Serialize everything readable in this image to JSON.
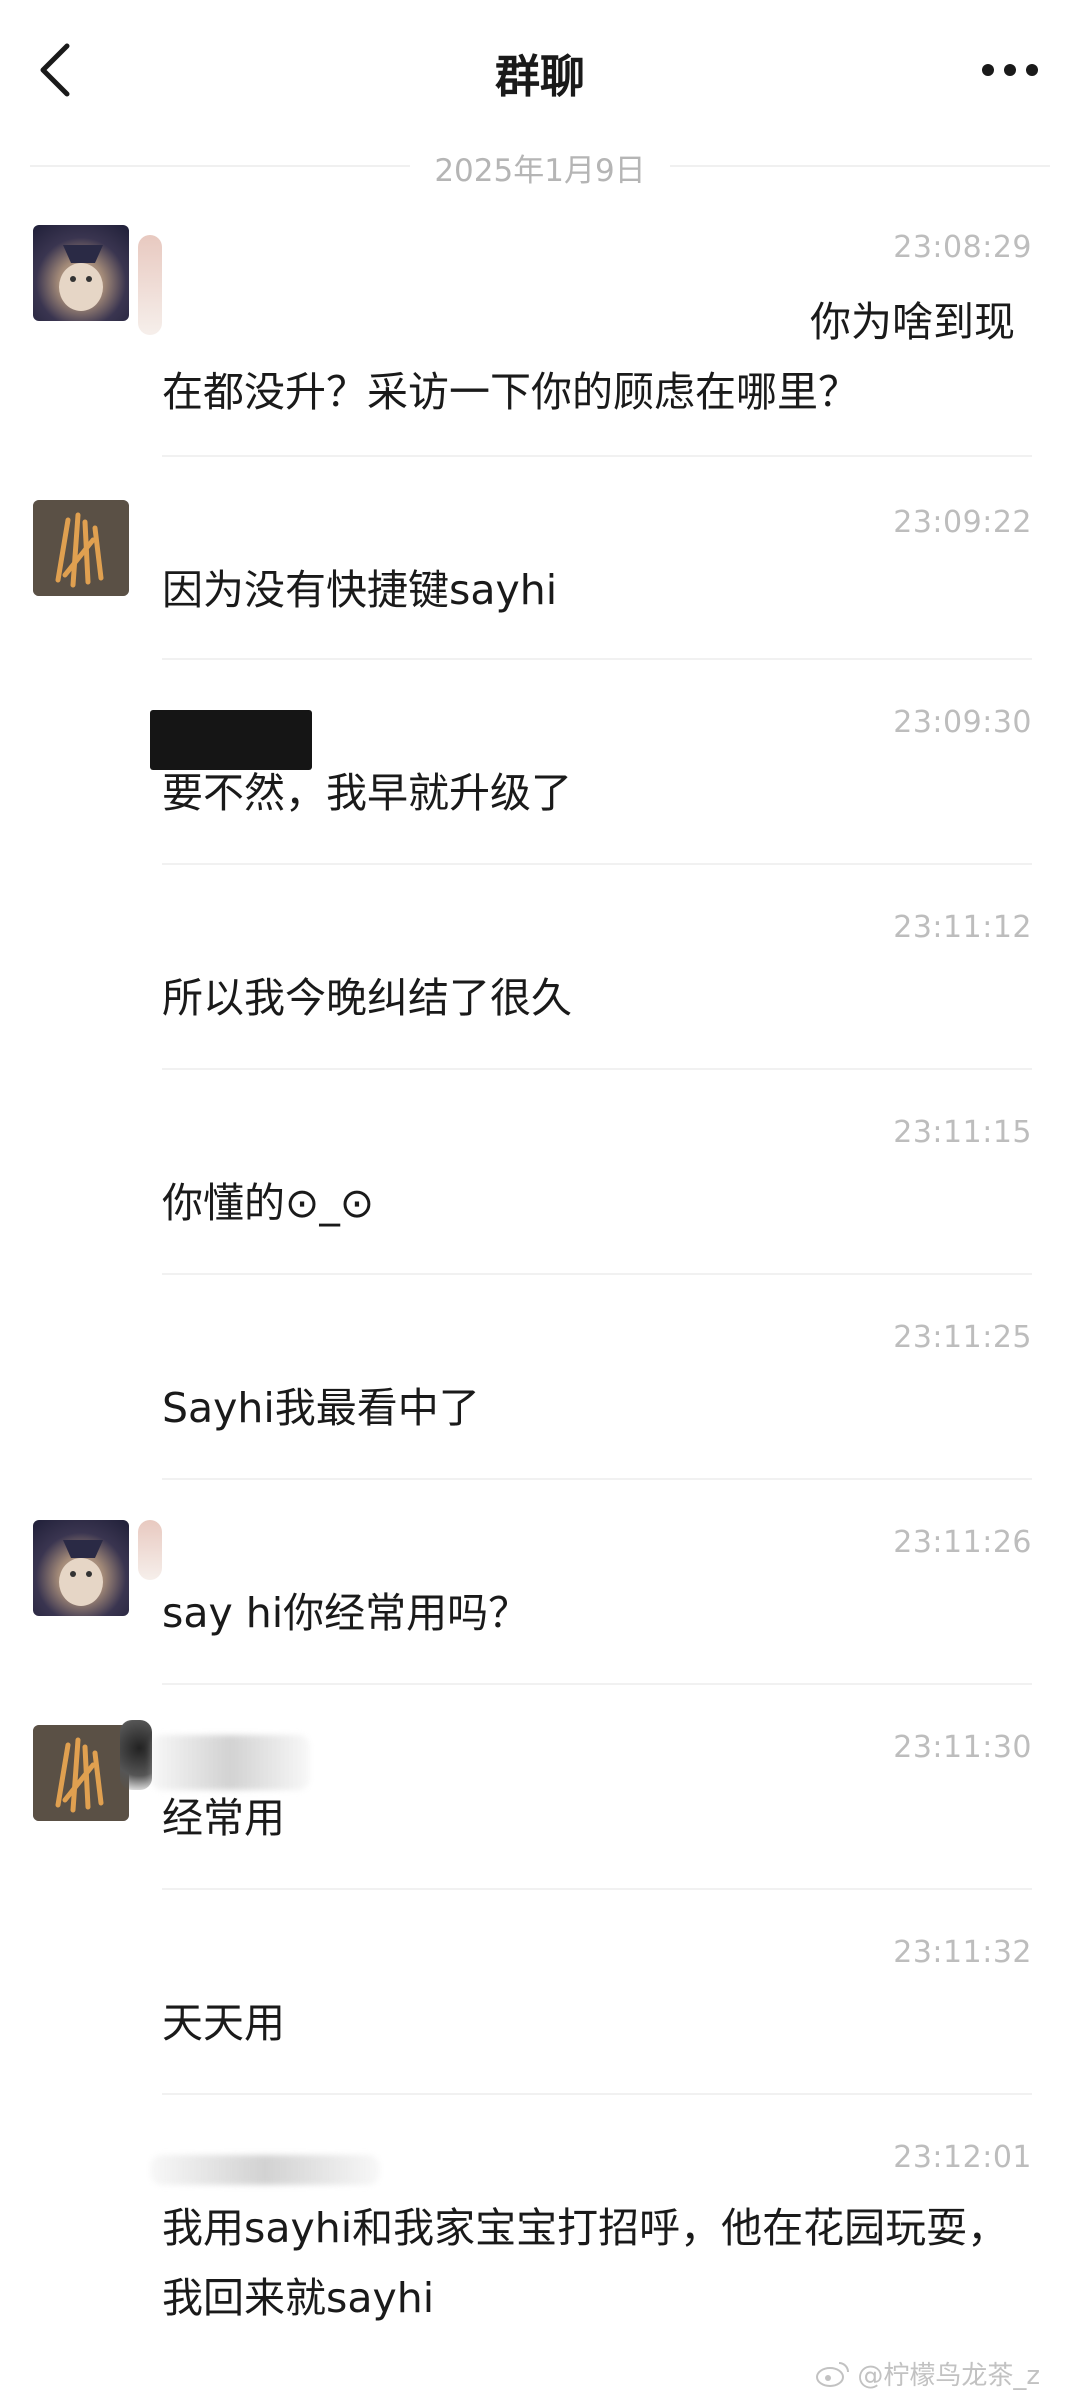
{
  "header": {
    "back_icon": "chevron-left-icon",
    "title": "群聊",
    "more_icon": "more-horizontal-icon"
  },
  "date_separator": "2025年1月9日",
  "messages": [
    {
      "time": "23:08:29",
      "avatar": "cat",
      "text": "你为啥到现在都没升？采访一下你的顾虑在哪里？"
    },
    {
      "time": "23:09:22",
      "avatar": "fries",
      "text": "因为没有快捷键sayhi"
    },
    {
      "time": "23:09:30",
      "avatar": "none",
      "text": "要不然，我早就升级了"
    },
    {
      "time": "23:11:12",
      "avatar": "none",
      "text": "所以我今晚纠结了很久"
    },
    {
      "time": "23:11:15",
      "avatar": "none",
      "text": "你懂的⊙_⊙"
    },
    {
      "time": "23:11:25",
      "avatar": "none",
      "text": "Sayhi我最看中了"
    },
    {
      "time": "23:11:26",
      "avatar": "cat",
      "text": "say hi你经常用吗？"
    },
    {
      "time": "23:11:30",
      "avatar": "fries",
      "text": "经常用"
    },
    {
      "time": "23:11:32",
      "avatar": "none",
      "text": "天天用"
    },
    {
      "time": "23:12:01",
      "avatar": "none",
      "text": "我用sayhi和我家宝宝打招呼，他在花园玩耍，我回来就sayhi"
    }
  ],
  "watermark": "@柠檬鸟龙茶_z",
  "watermark_icon": "weibo-icon"
}
